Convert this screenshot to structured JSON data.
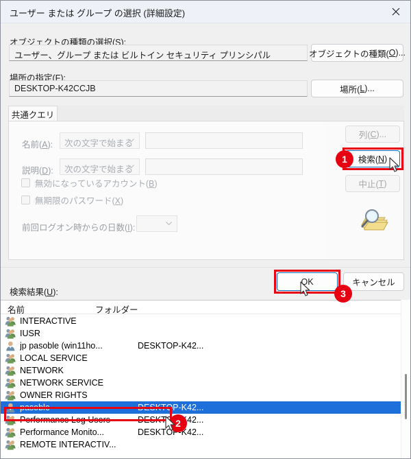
{
  "window": {
    "title": "ユーザー または グループ の選択 (詳細設定)",
    "close_icon": "close-icon"
  },
  "object_type": {
    "label": "オブジェクトの種類の選択(S):",
    "value": "ユーザー、グループ または ビルトイン セキュリティ プリンシパル",
    "button": "オブジェクトの種類(O)..."
  },
  "location": {
    "label": "場所の指定(F):",
    "value": "DESKTOP-K42CCJB",
    "button": "場所(L)..."
  },
  "tabs": [
    {
      "label": "共通クエリ",
      "active": true
    }
  ],
  "query": {
    "name_label": "名前(A):",
    "name_condition": "次の文字で始まる",
    "name_value": "",
    "desc_label": "説明(D):",
    "desc_condition": "次の文字で始まる",
    "desc_value": "",
    "disabled_accounts_label": "無効になっているアカウント(B)",
    "disabled_accounts_checked": false,
    "nonexpiring_password_label": "無期限のパスワード(X)",
    "nonexpiring_password_checked": false,
    "days_since_logon_label": "前回ログオン時からの日数(I):",
    "days_since_logon_value": ""
  },
  "side_buttons": {
    "columns": "列(C)...",
    "search": "検索(N)",
    "stop": "中止(T)"
  },
  "dialog_buttons": {
    "ok": "OK",
    "cancel": "キャンセル"
  },
  "results": {
    "label": "検索結果(U):",
    "columns": [
      "名前",
      "フォルダー"
    ],
    "rows": [
      {
        "icon": "group-icon",
        "name": "INTERACTIVE",
        "folder": "",
        "selected": false
      },
      {
        "icon": "group-icon",
        "name": "IUSR",
        "folder": "",
        "selected": false
      },
      {
        "icon": "user-icon",
        "name": "jp pasoble (win11ho...",
        "folder": "DESKTOP-K42...",
        "selected": false
      },
      {
        "icon": "group-icon",
        "name": "LOCAL SERVICE",
        "folder": "",
        "selected": false
      },
      {
        "icon": "group-icon",
        "name": "NETWORK",
        "folder": "",
        "selected": false
      },
      {
        "icon": "group-icon",
        "name": "NETWORK SERVICE",
        "folder": "",
        "selected": false
      },
      {
        "icon": "group-icon",
        "name": "OWNER RIGHTS",
        "folder": "",
        "selected": false
      },
      {
        "icon": "user-icon",
        "name": "pasoble",
        "folder": "DESKTOP-K42...",
        "selected": true
      },
      {
        "icon": "group-icon",
        "name": "Performance Log Users",
        "folder": "DESKTOP-K42...",
        "selected": false
      },
      {
        "icon": "group-icon",
        "name": "Performance Monito...",
        "folder": "DESKTOP-K42...",
        "selected": false
      },
      {
        "icon": "group-icon",
        "name": "REMOTE INTERACTIV...",
        "folder": "",
        "selected": false
      }
    ]
  },
  "annotations": {
    "badge1": "1",
    "badge2": "2",
    "badge3": "3",
    "highlight_color": "#e60012",
    "selection_color": "#1e6fd9"
  },
  "decor": {
    "search_illustration": "magnifier-folder-icon"
  }
}
